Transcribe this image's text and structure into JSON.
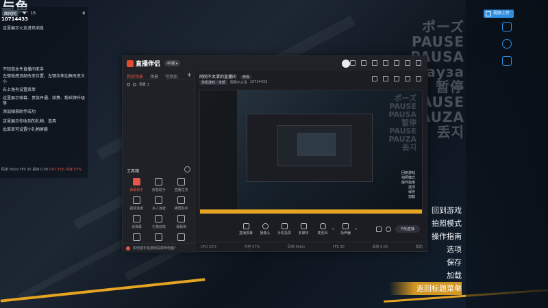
{
  "game": {
    "logo": "与鱼",
    "pause_words": [
      "ポーズ",
      "PAUSE",
      "PAUSA",
      "ауза",
      "暂停",
      "PAUSE",
      "PAUZA",
      "丢지"
    ],
    "menu": [
      "回到游戏",
      "拍照模式",
      "操作指南",
      "选项",
      "保存",
      "加载",
      "返回标题菜单"
    ]
  },
  "right_ui": {
    "share_label": "视频上传"
  },
  "left_overlay": {
    "badge": "图网网",
    "likes": "16",
    "room_id": "10714433",
    "messages": [
      "这里展示火友进场消息",
      "不知道本件直播间老手",
      "左键拖拽顶部改变位置，左键拉伸边框改变大小",
      "右上角有设置菜单",
      "这里展示弹幕、贵族开通、续费、粉丝牌升级等",
      "添加弹幕助手成功",
      "这里展示你收到的礼物、道具",
      "此菜单可设置小礼物屏蔽"
    ],
    "stats_left": "码率 0kb/s FPS 30 丢帧 0.00",
    "stats_right": "CPU 33% 内存 57%"
  },
  "app": {
    "title": "直播伴侣",
    "version": "40版 ▸",
    "tabs": [
      "我的场景",
      "场景",
      "可添加"
    ],
    "add_label": "+",
    "scene": "场景 1",
    "toolbox_title": "工具箱",
    "tools": [
      {
        "label": "弹幕助手",
        "active": true
      },
      {
        "label": "房管助手",
        "active": false
      },
      {
        "label": "直播任务",
        "active": false
      },
      {
        "label": "视频连麦",
        "active": false
      },
      {
        "label": "多人连麦",
        "active": false
      },
      {
        "label": "横屏助手",
        "active": false
      },
      {
        "label": "读弹幕",
        "active": false
      },
      {
        "label": "礼物动效",
        "active": false
      },
      {
        "label": "弹幕库",
        "active": false
      },
      {
        "label": "",
        "active": false
      },
      {
        "label": "",
        "active": false
      },
      {
        "label": "",
        "active": false
      }
    ],
    "footer_text": "如何把手机游戏投屏到电脑?",
    "room": {
      "title": "网网不太清的直播间",
      "edit": "修改",
      "category": "单机游戏 · 全部",
      "name": "网网不太清",
      "id": "10714433"
    },
    "bottom_bar": [
      {
        "label": "直播屏幕"
      },
      {
        "label": "摄像头"
      },
      {
        "label": "手机投屏"
      },
      {
        "label": "多媒体"
      },
      {
        "label": "麦克风"
      },
      {
        "label": "扬声器"
      }
    ],
    "go_live": "开始直播",
    "status": [
      "CPU 33%",
      "内存 57%",
      "码率 0kb/s",
      "FPS 30",
      "丢帧 0.00",
      "帮助"
    ]
  },
  "preview": {
    "words": [
      "ポーズ",
      "PAUSE",
      "PAUSA",
      "暂停",
      "PAUSE",
      "PAUZA",
      "丢지"
    ],
    "menu": [
      "回到游戏",
      "拍照模式",
      "操作指南",
      "选项",
      "保存",
      "加载"
    ]
  },
  "colors": {
    "accent_red": "#e4574a",
    "accent_gold": "#e7a422",
    "accent_blue": "#2f8fe0"
  }
}
